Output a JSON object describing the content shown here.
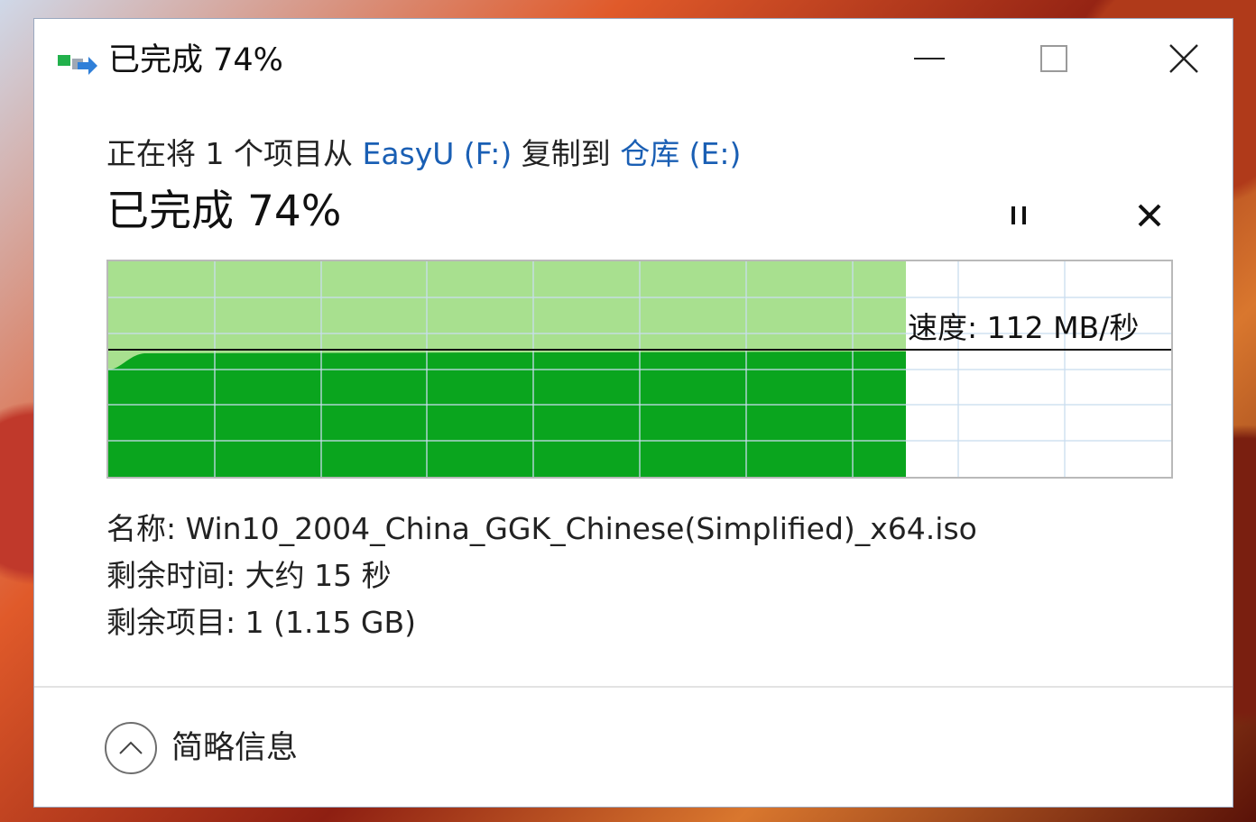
{
  "window": {
    "title": "已完成 74%"
  },
  "copy": {
    "prefix": "正在将 1 个项目从 ",
    "source": "EasyU (F:)",
    "middle": " 复制到 ",
    "destination": "仓库 (E:)"
  },
  "progress": {
    "label": "已完成 74%",
    "fraction": 0.74,
    "current_speed_fraction": 0.42
  },
  "graph": {
    "speed_label": "速度: 112 MB/秒",
    "colors": {
      "completed_bg": "#a8e08f",
      "speed_fill": "#0aa51e",
      "grid": "#c9ddef",
      "speed_line": "#111111"
    }
  },
  "details": {
    "name_label": "名称: Win10_2004_China_GGK_Chinese(Simplified)_x64.iso",
    "time_label": "剩余时间: 大约 15 秒",
    "items_label": "剩余项目: 1 (1.15 GB)"
  },
  "footer": {
    "toggle_label": "简略信息"
  },
  "icons": {
    "app": "copy-transfer-icon",
    "minimize": "minimize-icon",
    "maximize": "maximize-icon",
    "close": "close-icon",
    "pause": "pause-icon",
    "cancel": "cancel-icon",
    "collapse": "chevron-up-icon"
  }
}
